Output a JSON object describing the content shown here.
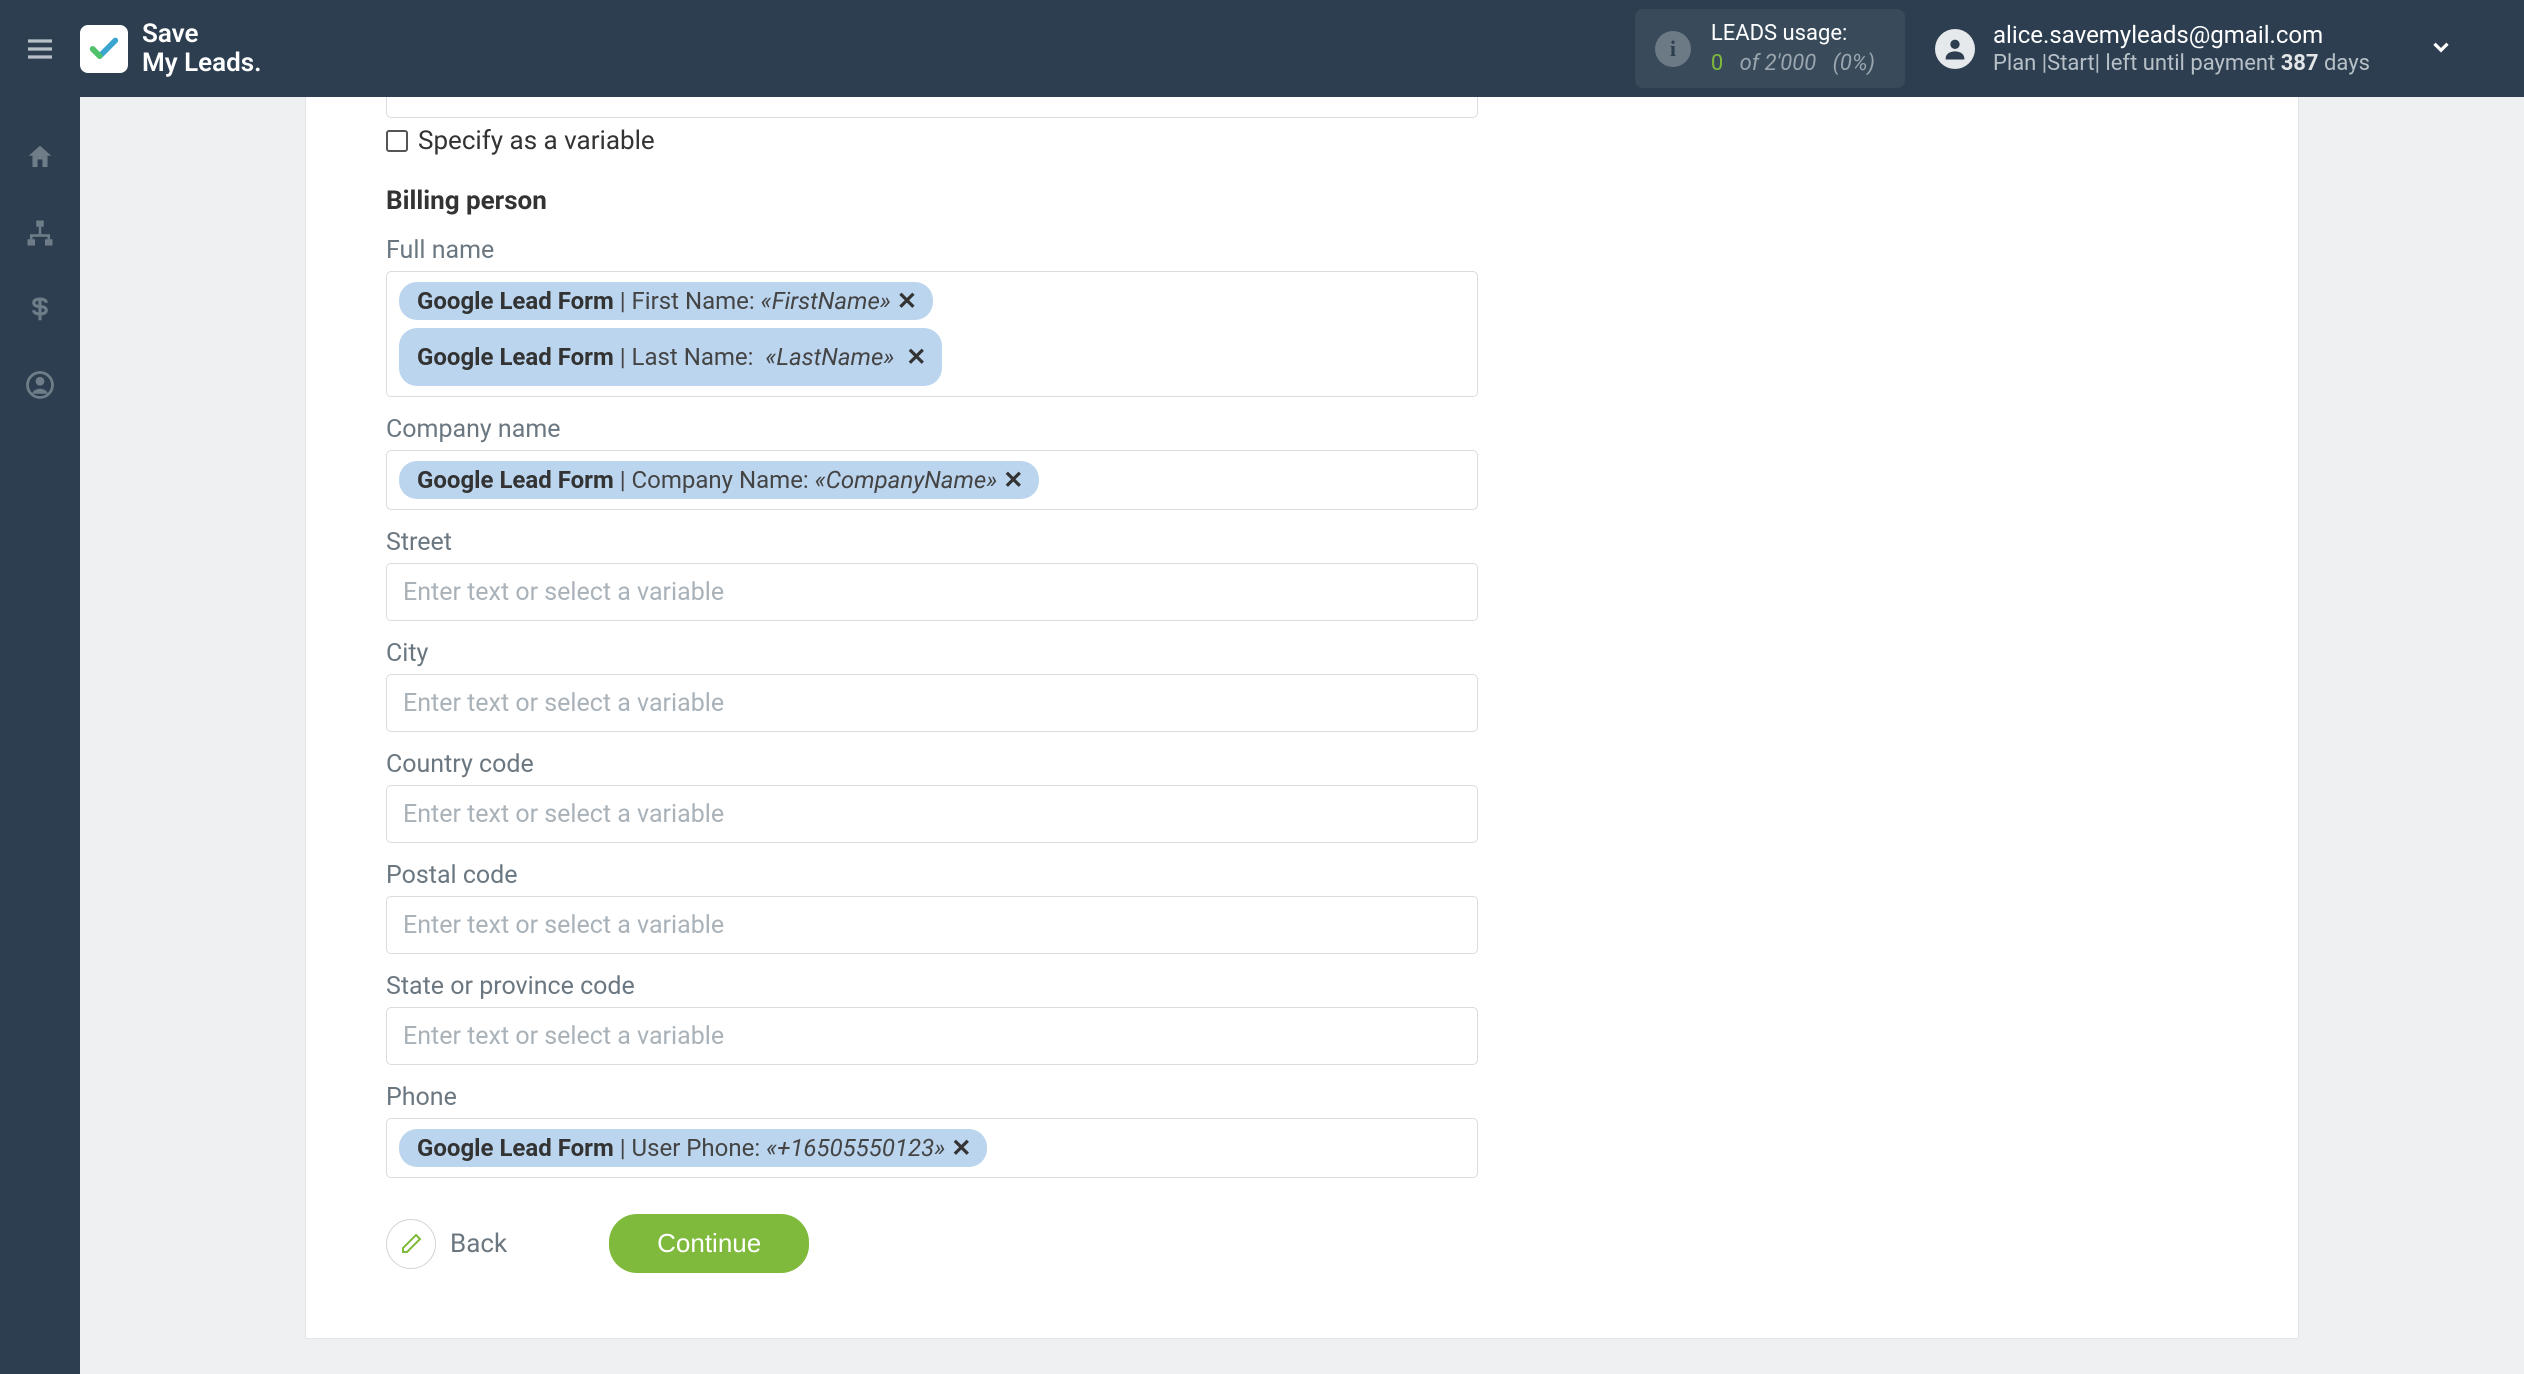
{
  "brand": {
    "line1": "Save",
    "line2": "My Leads."
  },
  "header": {
    "leads_usage_label": "LEADS usage:",
    "leads_usage_zero": "0",
    "leads_usage_of": "of 2'000",
    "leads_usage_pct": "(0%)",
    "email": "alice.savemyleads@gmail.com",
    "plan_prefix": "Plan |Start| left until payment ",
    "plan_days_number": "387",
    "plan_days_suffix": " days"
  },
  "form": {
    "specify_variable_label": "Specify as a variable",
    "section_title": "Billing person",
    "fields": {
      "full_name": {
        "label": "Full name"
      },
      "company_name": {
        "label": "Company name"
      },
      "street": {
        "label": "Street",
        "placeholder": "Enter text or select a variable"
      },
      "city": {
        "label": "City",
        "placeholder": "Enter text or select a variable"
      },
      "country_code": {
        "label": "Country code",
        "placeholder": "Enter text or select a variable"
      },
      "postal_code": {
        "label": "Postal code",
        "placeholder": "Enter text or select a variable"
      },
      "state_code": {
        "label": "State or province code",
        "placeholder": "Enter text or select a variable"
      },
      "phone": {
        "label": "Phone"
      }
    },
    "tags": {
      "source": "Google Lead Form",
      "first_name_label": "First Name:",
      "first_name_value": "«FirstName»",
      "last_name_label": "Last Name:",
      "last_name_value": "«LastName»",
      "company_label": "Company Name:",
      "company_value": "«CompanyName»",
      "phone_label": "User Phone:",
      "phone_value": "«+16505550123»",
      "remove": "✕"
    },
    "buttons": {
      "back": "Back",
      "continue": "Continue"
    }
  },
  "colors": {
    "header_bg": "#2c3e50",
    "accent_green": "#7fba3c",
    "tag_bg": "#bcd5ee",
    "label_grey": "#6b7780"
  }
}
